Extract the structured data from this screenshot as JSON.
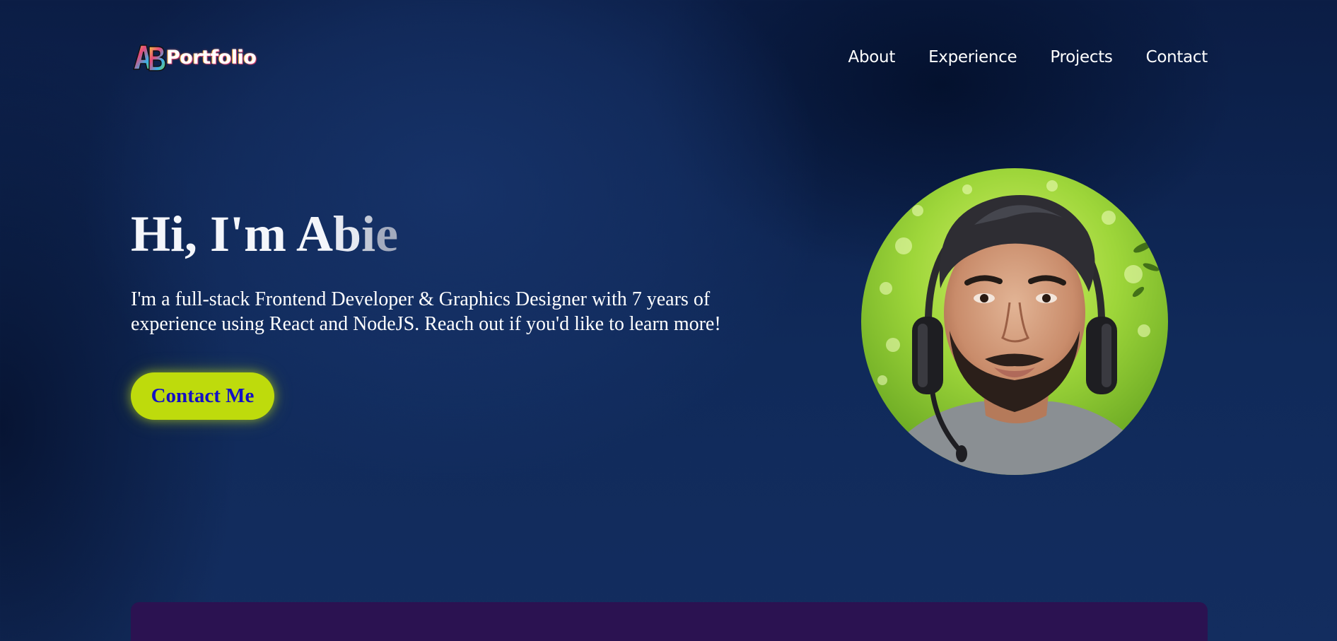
{
  "header": {
    "logo_text": "Portfolio",
    "nav": [
      {
        "label": "About"
      },
      {
        "label": "Experience"
      },
      {
        "label": "Projects"
      },
      {
        "label": "Contact"
      }
    ]
  },
  "hero": {
    "title_solid": "Hi, I'm A",
    "title_fade_1": "b",
    "title_fade_2": "i",
    "title_fade_3": "e",
    "description": "I'm a full-stack Frontend Developer & Graphics Designer with 7 years of experience using React and NodeJS. Reach out if you'd like to learn more!",
    "cta_label": "Contact Me"
  },
  "colors": {
    "background": "#0a1a3d",
    "accent": "#bedb0c",
    "cta_text": "#1410c4",
    "card": "#2b1251"
  }
}
